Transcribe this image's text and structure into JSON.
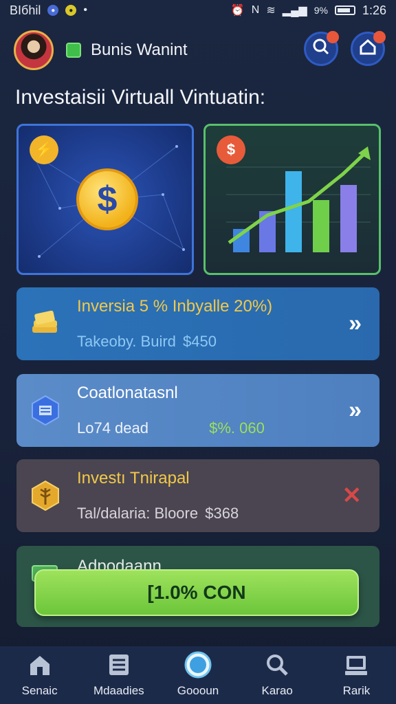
{
  "status_bar": {
    "left_text": "BIбhil",
    "time": "1:26",
    "battery_text": "9%"
  },
  "header": {
    "app_name": "Bunis Wanint"
  },
  "main": {
    "title": "Investaisii Virtuall Vintuatin:",
    "cards": [
      {
        "symbol": "$"
      },
      {
        "symbol": "$"
      }
    ],
    "rows": [
      {
        "title": "Inversia 5 % Inbyalle 20%)",
        "subtitle": "Takeoby. Buird",
        "amount": "$450",
        "action": "»"
      },
      {
        "title": "Coatlonatasnl",
        "subtitle": "Lo74 dead",
        "amount": "$%. 060",
        "action": "»"
      },
      {
        "title": "Investı Tnirapal",
        "subtitle": "Tal/dalaria: Bloore",
        "amount": "$368",
        "action": "✕"
      },
      {
        "title": "Adpodaann"
      }
    ],
    "cta_label": "[1.0% CON"
  },
  "navbar": {
    "items": [
      {
        "label": "Senaic",
        "icon": "home-icon"
      },
      {
        "label": "Mdaadies",
        "icon": "ledger-icon"
      },
      {
        "label": "Goooun",
        "icon": "globe-icon"
      },
      {
        "label": "Karao",
        "icon": "search-icon"
      },
      {
        "label": "Rarik",
        "icon": "briefcase-icon"
      }
    ]
  },
  "colors": {
    "accent_green": "#7fd34a",
    "accent_blue": "#2b72b8",
    "gold": "#f2c22e"
  }
}
